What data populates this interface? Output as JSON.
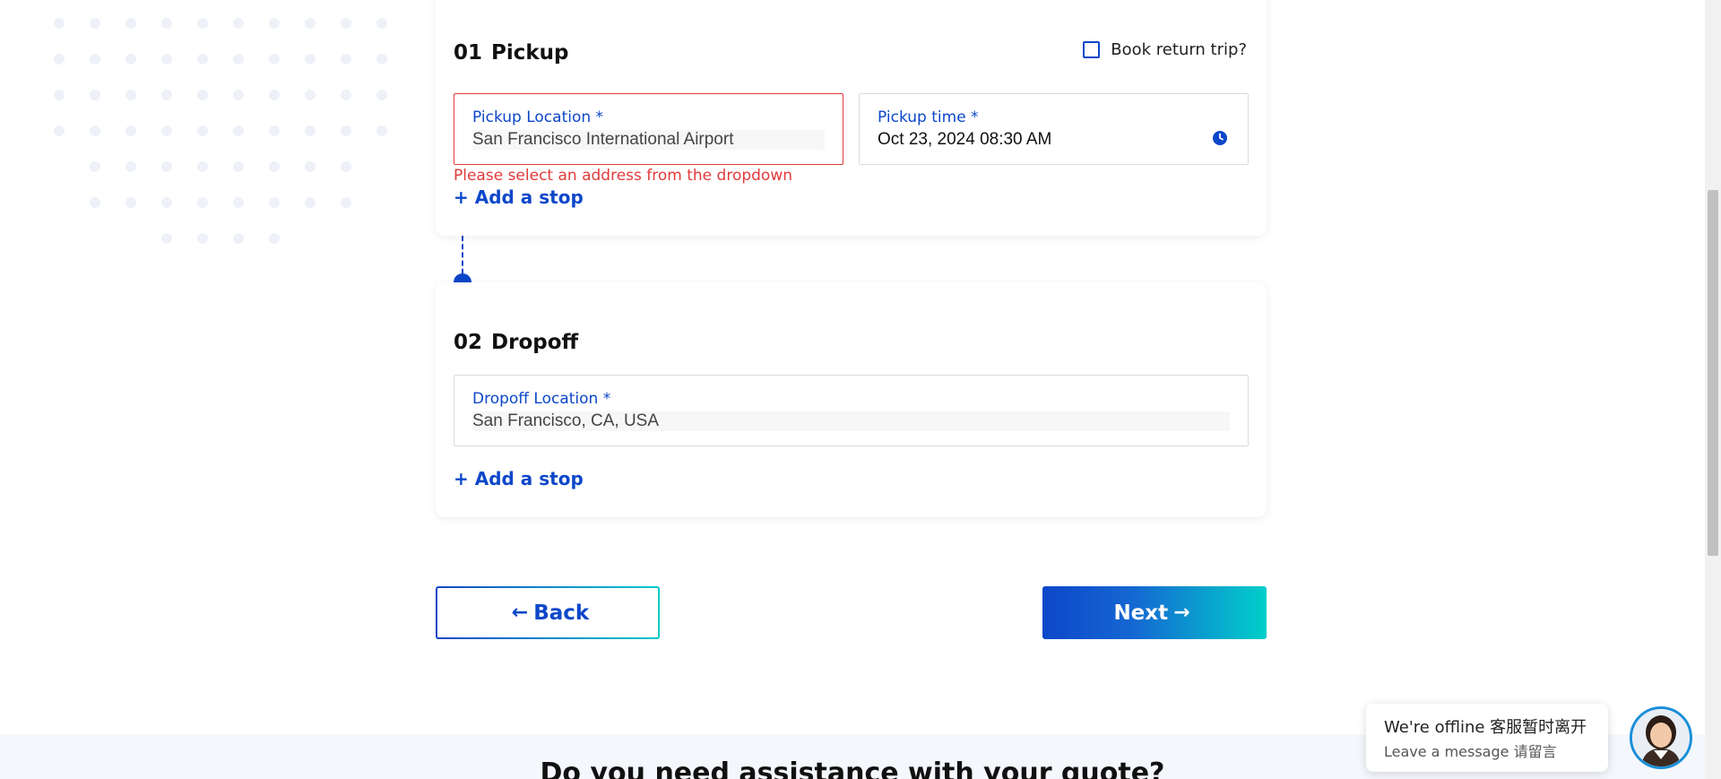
{
  "pickup": {
    "step_number": "01",
    "step_title": "Pickup",
    "return_trip_label": "Book return trip?",
    "location_label": "Pickup Location *",
    "location_value": "San Francisco International Airport",
    "error_message": "Please select an address from the dropdown",
    "time_label": "Pickup time *",
    "time_value": "Oct 23, 2024 08:30 AM",
    "add_stop": "+ Add a stop"
  },
  "dropoff": {
    "step_number": "02",
    "step_title": "Dropoff",
    "location_label": "Dropoff Location *",
    "location_value": "San Francisco, CA, USA",
    "add_stop": "+ Add a stop"
  },
  "navigation": {
    "back_label": "Back",
    "next_label": "Next"
  },
  "footer": {
    "heading": "Do you need assistance with your quote?"
  },
  "chat": {
    "status_line": "We're offline 客服暂时离开",
    "message_line": "Leave a message 请留言"
  },
  "colors": {
    "primary": "#0d47c9",
    "accent": "#00cfca",
    "error": "#e23a3a"
  },
  "icons": {
    "time": "clock-icon",
    "back": "arrow-left-icon",
    "next": "arrow-right-icon"
  }
}
